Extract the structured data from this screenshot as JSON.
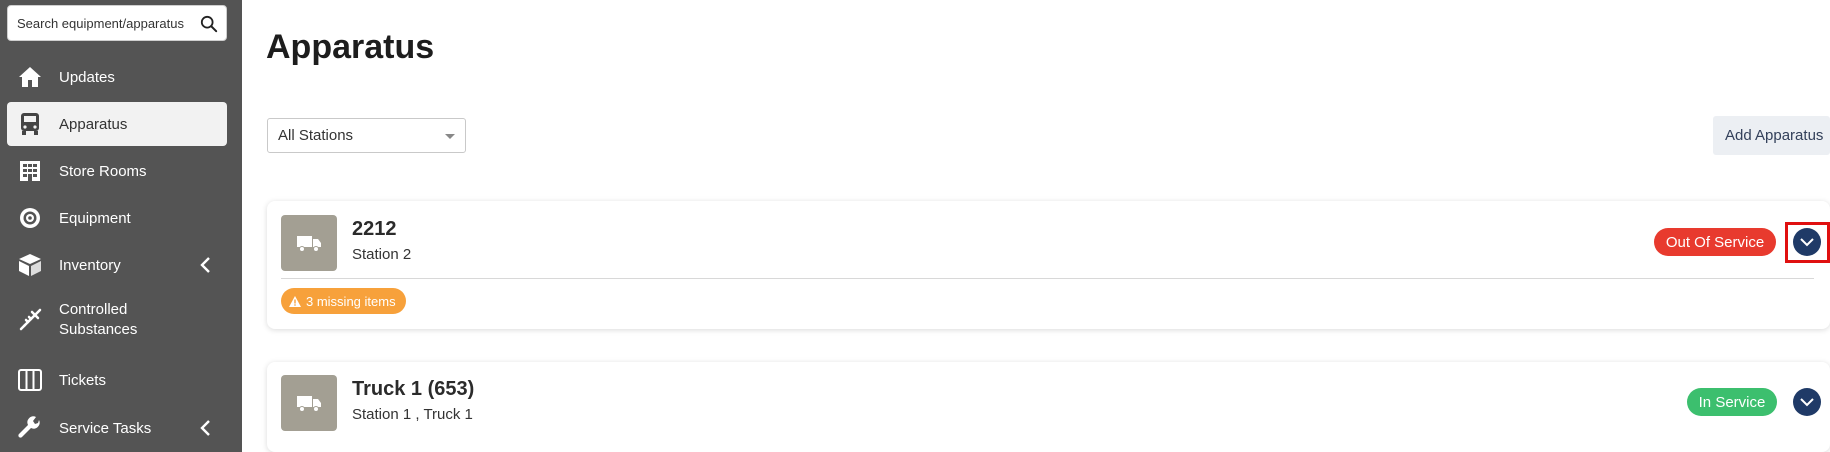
{
  "sidebar": {
    "search_placeholder": "Search equipment/apparatus",
    "items": [
      {
        "label": "Updates",
        "icon": "home-icon"
      },
      {
        "label": "Apparatus",
        "icon": "bus-icon",
        "active": true
      },
      {
        "label": "Store Rooms",
        "icon": "storeroom-icon"
      },
      {
        "label": "Equipment",
        "icon": "gear-icon"
      },
      {
        "label": "Inventory",
        "icon": "box-icon",
        "has_chevron": true
      },
      {
        "label": "Controlled Substances",
        "icon": "syringe-icon"
      },
      {
        "label": "Tickets",
        "icon": "columns-icon"
      },
      {
        "label": "Service Tasks",
        "icon": "wrench-icon",
        "has_chevron": true
      }
    ]
  },
  "main": {
    "title": "Apparatus",
    "station_filter": {
      "selected": "All Stations"
    },
    "add_button_label": "Add Apparatus",
    "apparatus": [
      {
        "name": "2212",
        "subtitle": "Station 2",
        "status": "Out Of Service",
        "status_color": "#e83a2e",
        "warning": "3 missing items",
        "highlighted": true
      },
      {
        "name": "Truck 1 (653)",
        "subtitle": "Station 1 , Truck 1",
        "status": "In Service",
        "status_color": "#3cbf6e"
      }
    ]
  },
  "colors": {
    "sidebar_bg": "#545454",
    "accent": "#1f3a67",
    "warning": "#f7a13b"
  }
}
